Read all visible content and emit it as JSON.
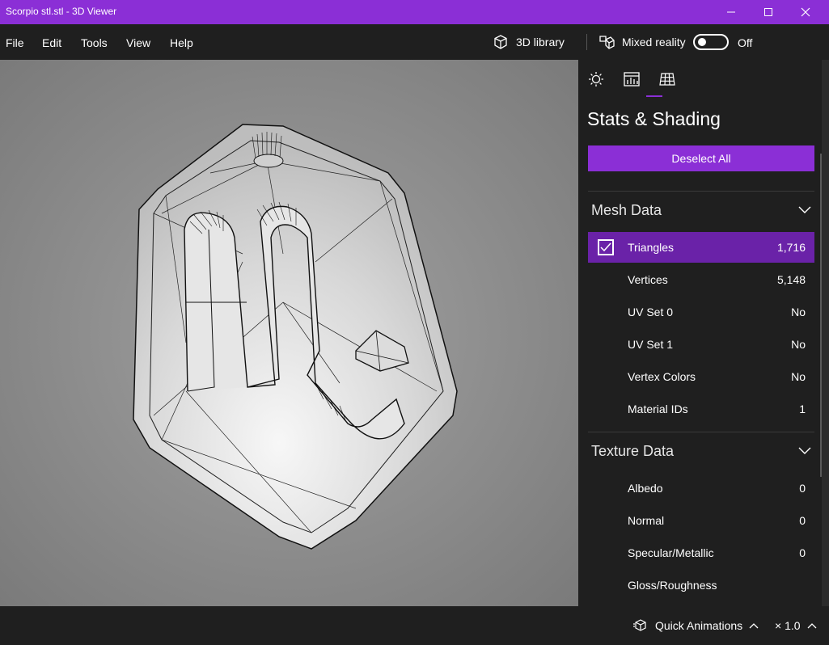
{
  "window": {
    "title": "Scorpio stl.stl - 3D Viewer"
  },
  "menu": {
    "items": [
      "File",
      "Edit",
      "Tools",
      "View",
      "Help"
    ]
  },
  "toolbar": {
    "library_label": "3D library",
    "mixed_reality_label": "Mixed reality",
    "mixed_reality_state": "Off"
  },
  "panel": {
    "title": "Stats & Shading",
    "deselect_label": "Deselect All",
    "mesh_section": {
      "label": "Mesh Data",
      "rows": [
        {
          "label": "Triangles",
          "value": "1,716",
          "selected": true
        },
        {
          "label": "Vertices",
          "value": "5,148"
        },
        {
          "label": "UV Set 0",
          "value": "No"
        },
        {
          "label": "UV Set 1",
          "value": "No"
        },
        {
          "label": "Vertex Colors",
          "value": "No"
        },
        {
          "label": "Material IDs",
          "value": "1"
        }
      ]
    },
    "texture_section": {
      "label": "Texture Data",
      "rows": [
        {
          "label": "Albedo",
          "value": "0"
        },
        {
          "label": "Normal",
          "value": "0"
        },
        {
          "label": "Specular/Metallic",
          "value": "0"
        },
        {
          "label": "Gloss/Roughness",
          "value": ""
        }
      ]
    }
  },
  "status": {
    "quick_animations_label": "Quick Animations",
    "speed_label": "× 1.0"
  },
  "colors": {
    "accent": "#8b2fd6",
    "selected_row": "#6a22a8",
    "background": "#1f1f1f"
  }
}
